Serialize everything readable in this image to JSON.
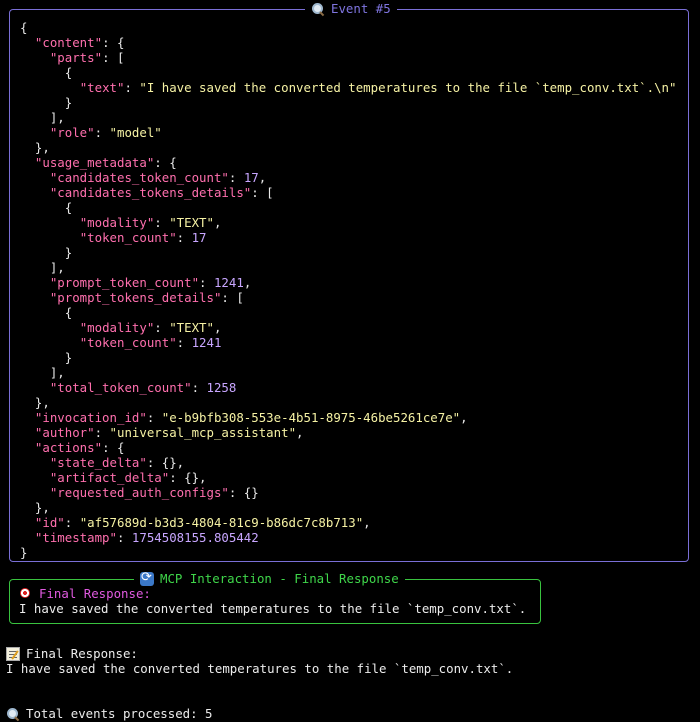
{
  "event_panel": {
    "title": "Event #5",
    "lines": [
      [
        {
          "t": "{",
          "c": "p"
        }
      ],
      [
        {
          "t": "  ",
          "c": "p"
        },
        {
          "t": "\"content\"",
          "c": "k"
        },
        {
          "t": ": {",
          "c": "p"
        }
      ],
      [
        {
          "t": "    ",
          "c": "p"
        },
        {
          "t": "\"parts\"",
          "c": "k"
        },
        {
          "t": ": [",
          "c": "p"
        }
      ],
      [
        {
          "t": "      {",
          "c": "p"
        }
      ],
      [
        {
          "t": "        ",
          "c": "p"
        },
        {
          "t": "\"text\"",
          "c": "k"
        },
        {
          "t": ": ",
          "c": "p"
        },
        {
          "t": "\"I have saved the converted temperatures to the file `temp_conv.txt`.\\n\"",
          "c": "s"
        }
      ],
      [
        {
          "t": "      }",
          "c": "p"
        }
      ],
      [
        {
          "t": "    ],",
          "c": "p"
        }
      ],
      [
        {
          "t": "    ",
          "c": "p"
        },
        {
          "t": "\"role\"",
          "c": "k"
        },
        {
          "t": ": ",
          "c": "p"
        },
        {
          "t": "\"model\"",
          "c": "s"
        }
      ],
      [
        {
          "t": "  },",
          "c": "p"
        }
      ],
      [
        {
          "t": "  ",
          "c": "p"
        },
        {
          "t": "\"usage_metadata\"",
          "c": "k"
        },
        {
          "t": ": {",
          "c": "p"
        }
      ],
      [
        {
          "t": "    ",
          "c": "p"
        },
        {
          "t": "\"candidates_token_count\"",
          "c": "k"
        },
        {
          "t": ": ",
          "c": "p"
        },
        {
          "t": "17",
          "c": "n"
        },
        {
          "t": ",",
          "c": "p"
        }
      ],
      [
        {
          "t": "    ",
          "c": "p"
        },
        {
          "t": "\"candidates_tokens_details\"",
          "c": "k"
        },
        {
          "t": ": [",
          "c": "p"
        }
      ],
      [
        {
          "t": "      {",
          "c": "p"
        }
      ],
      [
        {
          "t": "        ",
          "c": "p"
        },
        {
          "t": "\"modality\"",
          "c": "k"
        },
        {
          "t": ": ",
          "c": "p"
        },
        {
          "t": "\"TEXT\"",
          "c": "s"
        },
        {
          "t": ",",
          "c": "p"
        }
      ],
      [
        {
          "t": "        ",
          "c": "p"
        },
        {
          "t": "\"token_count\"",
          "c": "k"
        },
        {
          "t": ": ",
          "c": "p"
        },
        {
          "t": "17",
          "c": "n"
        }
      ],
      [
        {
          "t": "      }",
          "c": "p"
        }
      ],
      [
        {
          "t": "    ],",
          "c": "p"
        }
      ],
      [
        {
          "t": "    ",
          "c": "p"
        },
        {
          "t": "\"prompt_token_count\"",
          "c": "k"
        },
        {
          "t": ": ",
          "c": "p"
        },
        {
          "t": "1241",
          "c": "n"
        },
        {
          "t": ",",
          "c": "p"
        }
      ],
      [
        {
          "t": "    ",
          "c": "p"
        },
        {
          "t": "\"prompt_tokens_details\"",
          "c": "k"
        },
        {
          "t": ": [",
          "c": "p"
        }
      ],
      [
        {
          "t": "      {",
          "c": "p"
        }
      ],
      [
        {
          "t": "        ",
          "c": "p"
        },
        {
          "t": "\"modality\"",
          "c": "k"
        },
        {
          "t": ": ",
          "c": "p"
        },
        {
          "t": "\"TEXT\"",
          "c": "s"
        },
        {
          "t": ",",
          "c": "p"
        }
      ],
      [
        {
          "t": "        ",
          "c": "p"
        },
        {
          "t": "\"token_count\"",
          "c": "k"
        },
        {
          "t": ": ",
          "c": "p"
        },
        {
          "t": "1241",
          "c": "n"
        }
      ],
      [
        {
          "t": "      }",
          "c": "p"
        }
      ],
      [
        {
          "t": "    ],",
          "c": "p"
        }
      ],
      [
        {
          "t": "    ",
          "c": "p"
        },
        {
          "t": "\"total_token_count\"",
          "c": "k"
        },
        {
          "t": ": ",
          "c": "p"
        },
        {
          "t": "1258",
          "c": "n"
        }
      ],
      [
        {
          "t": "  },",
          "c": "p"
        }
      ],
      [
        {
          "t": "  ",
          "c": "p"
        },
        {
          "t": "\"invocation_id\"",
          "c": "k"
        },
        {
          "t": ": ",
          "c": "p"
        },
        {
          "t": "\"e-b9bfb308-553e-4b51-8975-46be5261ce7e\"",
          "c": "s"
        },
        {
          "t": ",",
          "c": "p"
        }
      ],
      [
        {
          "t": "  ",
          "c": "p"
        },
        {
          "t": "\"author\"",
          "c": "k"
        },
        {
          "t": ": ",
          "c": "p"
        },
        {
          "t": "\"universal_mcp_assistant\"",
          "c": "s"
        },
        {
          "t": ",",
          "c": "p"
        }
      ],
      [
        {
          "t": "  ",
          "c": "p"
        },
        {
          "t": "\"actions\"",
          "c": "k"
        },
        {
          "t": ": {",
          "c": "p"
        }
      ],
      [
        {
          "t": "    ",
          "c": "p"
        },
        {
          "t": "\"state_delta\"",
          "c": "k"
        },
        {
          "t": ": {},",
          "c": "p"
        }
      ],
      [
        {
          "t": "    ",
          "c": "p"
        },
        {
          "t": "\"artifact_delta\"",
          "c": "k"
        },
        {
          "t": ": {},",
          "c": "p"
        }
      ],
      [
        {
          "t": "    ",
          "c": "p"
        },
        {
          "t": "\"requested_auth_configs\"",
          "c": "k"
        },
        {
          "t": ": {}",
          "c": "p"
        }
      ],
      [
        {
          "t": "  },",
          "c": "p"
        }
      ],
      [
        {
          "t": "  ",
          "c": "p"
        },
        {
          "t": "\"id\"",
          "c": "k"
        },
        {
          "t": ": ",
          "c": "p"
        },
        {
          "t": "\"af57689d-b3d3-4804-81c9-b86dc7c8b713\"",
          "c": "s"
        },
        {
          "t": ",",
          "c": "p"
        }
      ],
      [
        {
          "t": "  ",
          "c": "p"
        },
        {
          "t": "\"timestamp\"",
          "c": "k"
        },
        {
          "t": ": ",
          "c": "p"
        },
        {
          "t": "1754508155.805442",
          "c": "n"
        }
      ],
      [
        {
          "t": "}",
          "c": "p"
        }
      ]
    ]
  },
  "final_panel": {
    "title": "MCP Interaction - Final Response",
    "label": "Final Response:",
    "text": "I have saved the converted temperatures to the file `temp_conv.txt`."
  },
  "bottom": {
    "label": "Final Response:",
    "text": "I have saved the converted temperatures to the file `temp_conv.txt`.",
    "total": "Total events processed: 5"
  },
  "colors": {
    "event_border": "#7a6fd6",
    "final_border": "#39c33f",
    "key": "#ff6fae",
    "string": "#f6f2a4",
    "number": "#c8a6ff"
  }
}
